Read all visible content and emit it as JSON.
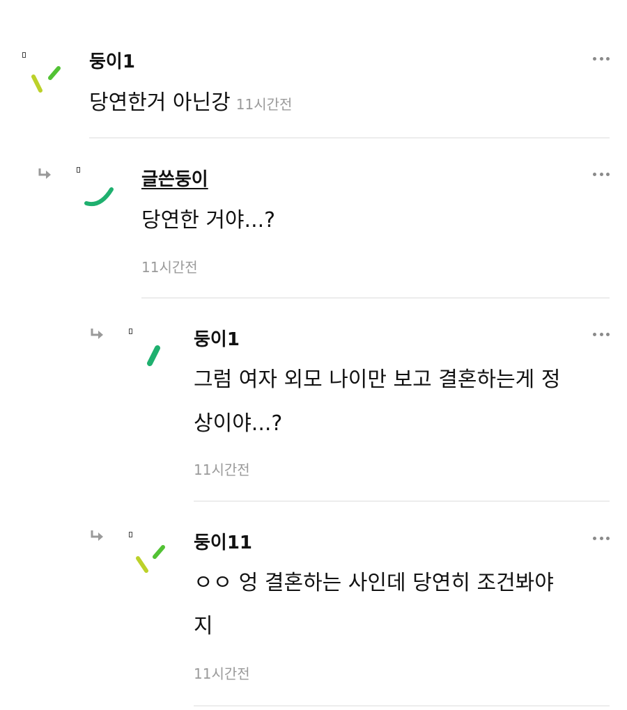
{
  "comments": [
    {
      "username": "둥이1",
      "content": "당연한거 아닌강",
      "time": "11시간전"
    },
    {
      "username": "글쓴둥이",
      "content": "당연한 거야...?",
      "time": "11시간전"
    },
    {
      "username": "둥이1",
      "content_line1": "그럼 여자 외모 나이만 보고 결혼하는게 정",
      "content_line2": "상이야...?",
      "time": "11시간전"
    },
    {
      "username": "둥이11",
      "content_line1": "ㅇㅇ 엉 결혼하는 사인데 당연히 조건봐야",
      "content_line2": "지",
      "time": "11시간전"
    }
  ],
  "icons": {
    "reply": "reply-arrow-icon",
    "more": "more-options-icon",
    "badge": "badge-icon"
  },
  "colors": {
    "avatar_green": "#1fb06f",
    "avatar_lime": "#bcd12a",
    "avatar_bright_green": "#52c234",
    "timestamp": "#9a9a9a",
    "divider": "#ececec"
  }
}
